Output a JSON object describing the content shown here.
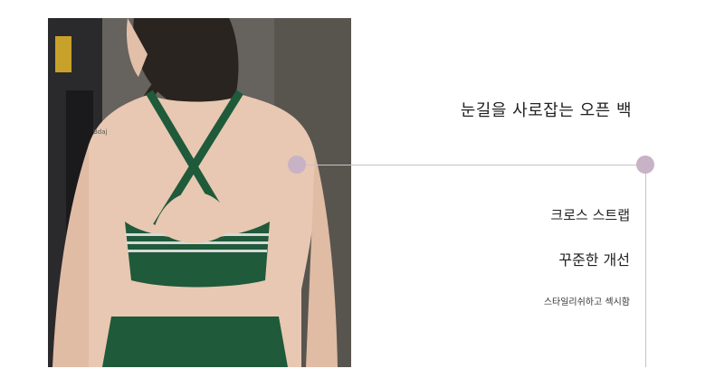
{
  "headline": "눈길을 사로잡는 오픈 백",
  "features": [
    "크로스 스트랩",
    "꾸준한 개선",
    "스타일리쉬하고 섹시함"
  ],
  "photo": {
    "subject": "back view of woman wearing green cross-strap sports bra",
    "colors": {
      "garment": "#1f5a3a",
      "wall": "#5f5c58",
      "skin": "#e8c8b2",
      "hair": "#2a2420"
    }
  },
  "accent_dot_color": "#c8b2c6",
  "line_color": "#c8c0cc"
}
